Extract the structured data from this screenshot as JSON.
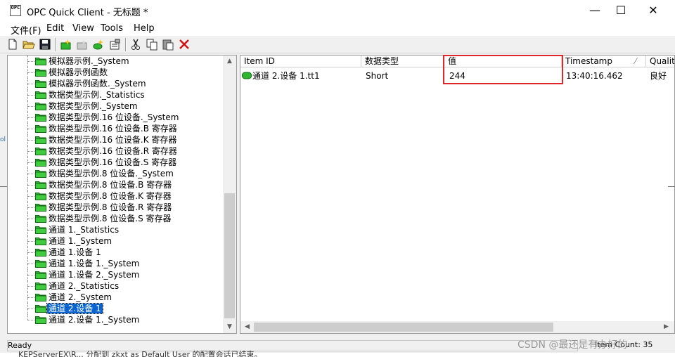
{
  "window": {
    "title": "OPC Quick Client - 无标题 *"
  },
  "app_icon": {
    "line1": "OPC",
    "line2": ""
  },
  "window_buttons": {
    "minimize": "—",
    "maximize": "☐",
    "close": "✕"
  },
  "menu": [
    "文件(F)",
    "Edit",
    "View",
    "Tools",
    "Help"
  ],
  "toolbar": {
    "icons": [
      "new-file-icon",
      "open-folder-icon",
      "save-icon",
      "new-server-icon",
      "new-group-icon",
      "new-item-icon",
      "properties-icon",
      "cut-icon",
      "copy-icon",
      "paste-icon",
      "delete-icon"
    ]
  },
  "tree": {
    "items": [
      "模拟器示例._System",
      "模拟器示例函数",
      "模拟器示例函数._System",
      "数据类型示例._Statistics",
      "数据类型示例._System",
      "数据类型示例.16 位设备._System",
      "数据类型示例.16 位设备.B 寄存器",
      "数据类型示例.16 位设备.K 寄存器",
      "数据类型示例.16 位设备.R 寄存器",
      "数据类型示例.16 位设备.S 寄存器",
      "数据类型示例.8 位设备._System",
      "数据类型示例.8 位设备.B 寄存器",
      "数据类型示例.8 位设备.K 寄存器",
      "数据类型示例.8 位设备.R 寄存器",
      "数据类型示例.8 位设备.S 寄存器",
      "通道 1._Statistics",
      "通道 1._System",
      "通道 1.设备 1",
      "通道 1.设备 1._System",
      "通道 1.设备 2._System",
      "通道 2._Statistics",
      "通道 2._System",
      "通道 2.设备 1",
      "通道 2.设备 1._System"
    ],
    "selected_index": 22
  },
  "list": {
    "columns": [
      "Item ID",
      "数据类型",
      "值",
      "Timestamp",
      "Qualit"
    ],
    "sort_indicator": "⁄",
    "rows": [
      {
        "item_id": "通道 2.设备 1.tt1",
        "data_type": "Short",
        "value": "244",
        "timestamp": "13:40:16.462",
        "quality": "良好"
      }
    ]
  },
  "scroll_arrows": {
    "up": "▲",
    "down": "▼",
    "left": "◀",
    "right": "▶"
  },
  "status": {
    "ready": "Ready",
    "item_count": "Item Count: 35"
  },
  "background_text": "KEPServerEX\\R...  分配到 zkxt as Default User 的配置会话已结束。",
  "edge_text": "ol",
  "watermark": "CSDN @最还是有办好的",
  "colors": {
    "selection": "#0a64d0",
    "highlight_box": "#e0282c",
    "folder": "#2fb52f"
  }
}
